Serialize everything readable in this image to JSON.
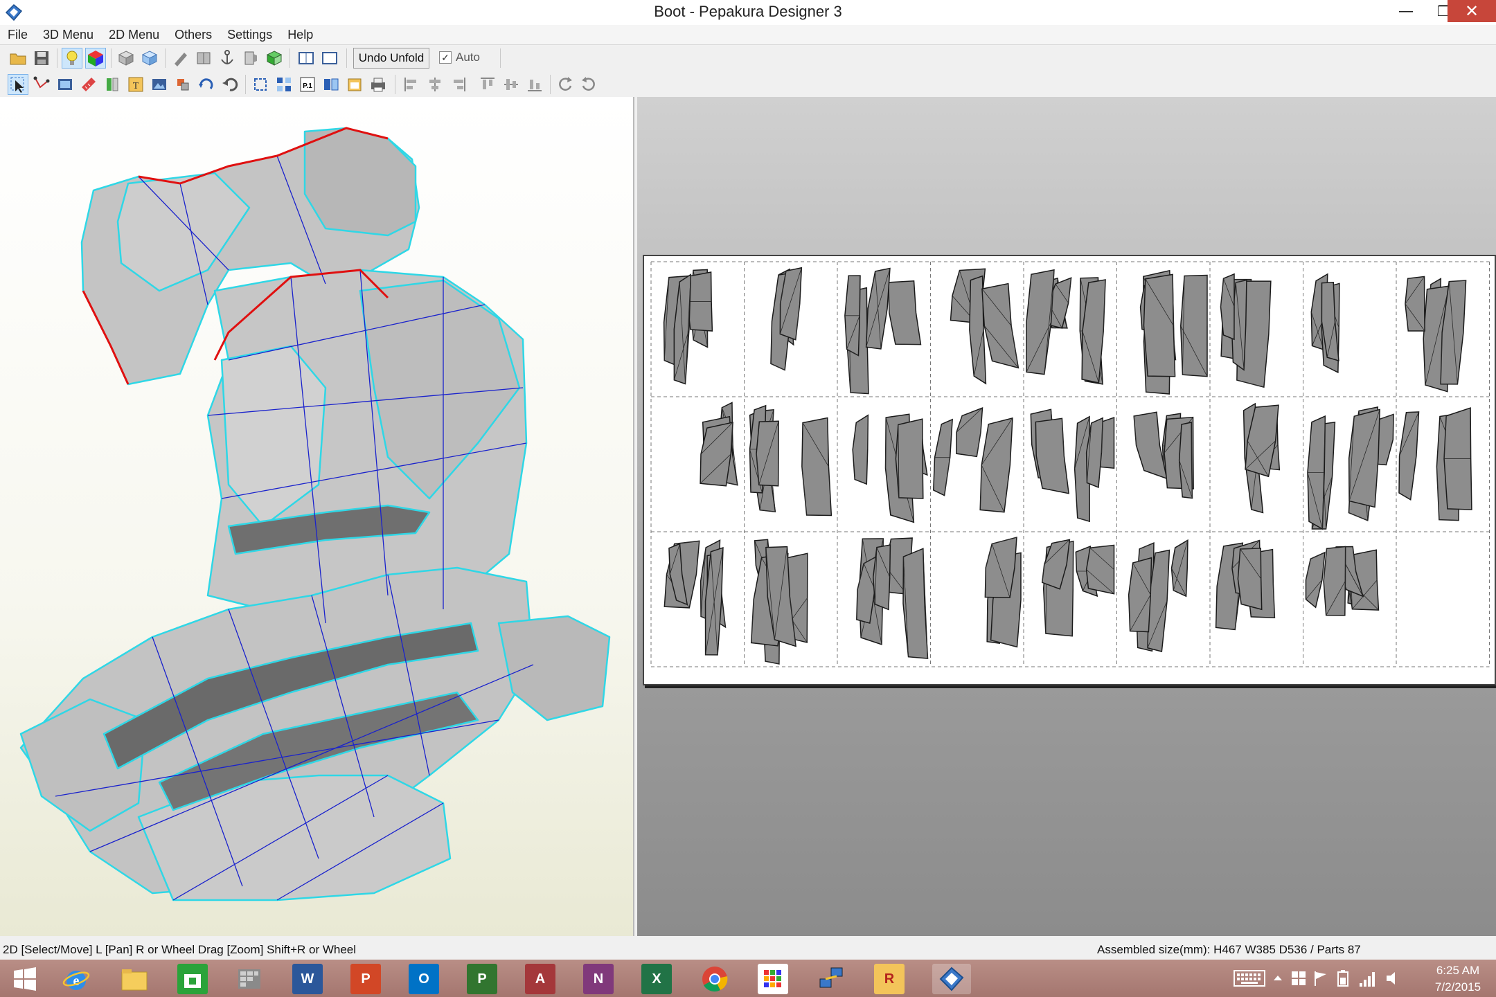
{
  "window": {
    "title": "Boot - Pepakura Designer 3",
    "min_icon": "minimize-icon",
    "max_icon": "restore-icon",
    "close_icon": "close-icon",
    "min_glyph": "—",
    "max_glyph": "❐",
    "close_glyph": "✕"
  },
  "menu": [
    "File",
    "3D Menu",
    "2D Menu",
    "Others",
    "Settings",
    "Help"
  ],
  "toolbar": {
    "undo_unfold_label": "Undo Unfold",
    "auto_label": "Auto",
    "auto_checked": true,
    "check_glyph": "✓"
  },
  "toolbar2_page_label": "P.1",
  "colors": {
    "accent_blue": "#3a78c9",
    "model_face": "#c8c8c8",
    "edge_cyan": "#2fd7e6",
    "fold_blue": "#1a22cc",
    "cut_red": "#e01010",
    "part_fill": "#8d8d8d",
    "close_red": "#c7463a"
  },
  "status": {
    "left": "2D [Select/Move] L [Pan] R or Wheel Drag [Zoom] Shift+R or Wheel",
    "right": "Assembled size(mm): H467 W385 D536 / Parts 87"
  },
  "taskbar": {
    "apps": [
      "start",
      "internet-explorer",
      "file-explorer",
      "store",
      "app-grid",
      "word",
      "powerpoint",
      "outlook",
      "project",
      "access",
      "onenote",
      "excel",
      "chrome",
      "app-launcher",
      "network-tool",
      "r-app",
      "pepakura"
    ],
    "time": "6:25 AM",
    "date": "7/2/2015"
  }
}
